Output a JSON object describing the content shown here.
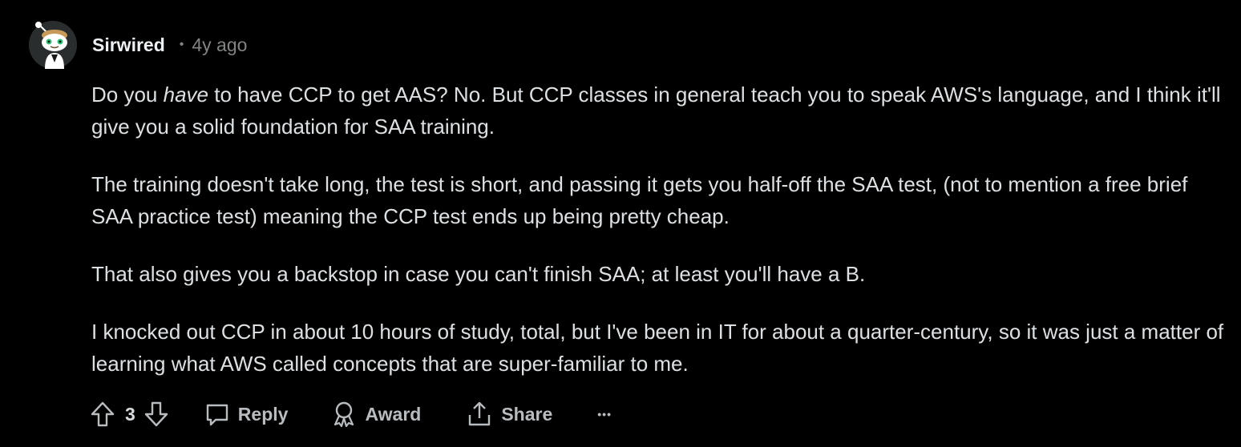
{
  "comment": {
    "author": "Sirwired",
    "separator": "•",
    "time_ago": "4y ago",
    "paragraphs": [
      {
        "before": "Do you ",
        "emphasis": "have",
        "after": " to have CCP to get AAS? No. But CCP classes in general teach you to speak AWS's language, and I think it'll give you a solid foundation for SAA training."
      },
      {
        "text": "The training doesn't take long, the test is short, and passing it gets you half-off the SAA test, (not to mention a free brief SAA practice test) meaning the CCP test ends up being pretty cheap."
      },
      {
        "text": "That also gives you a backstop in case you can't finish SAA; at least you'll have a B."
      },
      {
        "text": "I knocked out CCP in about 10 hours of study, total, but I've been in IT for about a quarter-century, so it was just a matter of learning what AWS called concepts that are super-familiar to me."
      }
    ]
  },
  "actions": {
    "vote_count": "3",
    "reply_label": "Reply",
    "award_label": "Award",
    "share_label": "Share",
    "more_label": "•••"
  },
  "icons": {
    "avatar": "snoo-avatar-icon",
    "upvote": "arrow-up-icon",
    "downvote": "arrow-down-icon",
    "reply": "speech-bubble-icon",
    "award": "award-ribbon-icon",
    "share": "share-upload-icon",
    "more": "ellipsis-icon"
  },
  "colors": {
    "background": "#000000",
    "text": "#dde0e2",
    "muted": "#818384",
    "action": "#b8bcbf"
  }
}
